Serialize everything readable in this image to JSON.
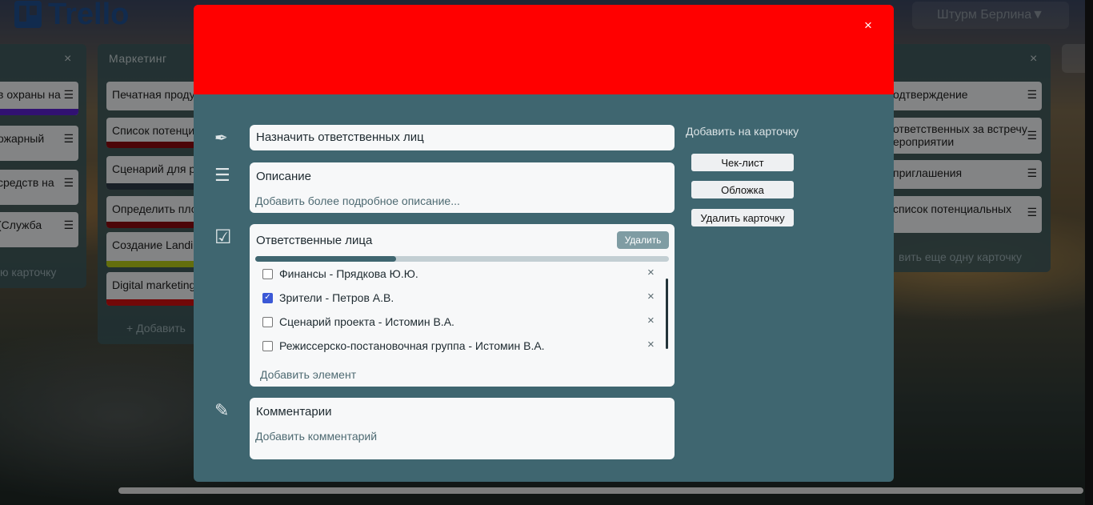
{
  "header": {
    "logo_text": "Trello",
    "team_button": "Штурм Берлина▼"
  },
  "lists": [
    {
      "title": "",
      "close": "×",
      "cards": [
        {
          "text": "в охраны на",
          "stripe": "#5a1fd0"
        },
        {
          "text": "ожарный",
          "stripe": ""
        },
        {
          "text": "средств на",
          "stripe": ""
        },
        {
          "text": "(Служба",
          "stripe": ""
        }
      ],
      "add_card": "ю карточку"
    },
    {
      "title": "Маркетинг",
      "cards": [
        {
          "text": "Печатная проду",
          "stripe": ""
        },
        {
          "text": "Список потенци",
          "stripe": "#8a0a10"
        },
        {
          "text": "Сценарий для р",
          "stripe": "#2f3b48"
        },
        {
          "text": "Определить пло",
          "stripe": "#8a0a10"
        },
        {
          "text": "Создание Landi",
          "stripe": "#b5c816"
        },
        {
          "text": "Digital marketing",
          "stripe": "#d01010"
        }
      ],
      "add_card": "+ Добавить"
    },
    {
      "title": "",
      "close": "×",
      "cards": [
        {
          "text": "одтверждение",
          "stripe": ""
        },
        {
          "line1": "ответственных за встречу",
          "line2": "ероприятии",
          "stripe": ""
        },
        {
          "text": "приглашения",
          "stripe": ""
        },
        {
          "text": "список потенциальных",
          "stripe": ""
        }
      ],
      "add_card": "вить еще одну карточку"
    }
  ],
  "modal": {
    "cover_color": "#ff0000",
    "close": "×",
    "title": "Назначить ответственных лиц",
    "description": {
      "heading": "Описание",
      "placeholder": "Добавить более подробное описание..."
    },
    "checklist": {
      "heading": "Ответственные лица",
      "delete_button": "Удалить",
      "progress": 0.34,
      "items": [
        {
          "label": "Финансы - Прядкова Ю.Ю.",
          "checked": false
        },
        {
          "label": "Зрители - Петров А.В.",
          "checked": true
        },
        {
          "label": "Сценарий проекта - Истомин В.А.",
          "checked": false
        },
        {
          "label": "Режиссерско-постановочная группа - Истомин В.А.",
          "checked": false
        }
      ],
      "item_remove": "×",
      "add_item": "Добавить элемент"
    },
    "comments": {
      "heading": "Комментарии",
      "placeholder": "Добавить комментарий"
    },
    "sidebar": {
      "heading": "Добавить на карточку",
      "buttons": [
        "Чек-лист",
        "Обложка",
        "Удалить карточку"
      ]
    },
    "icons": {
      "title": "pen-nib-icon",
      "description": "menu-lines-icon",
      "checklist": "checkbox-icon",
      "comments": "pencil-icon"
    }
  }
}
